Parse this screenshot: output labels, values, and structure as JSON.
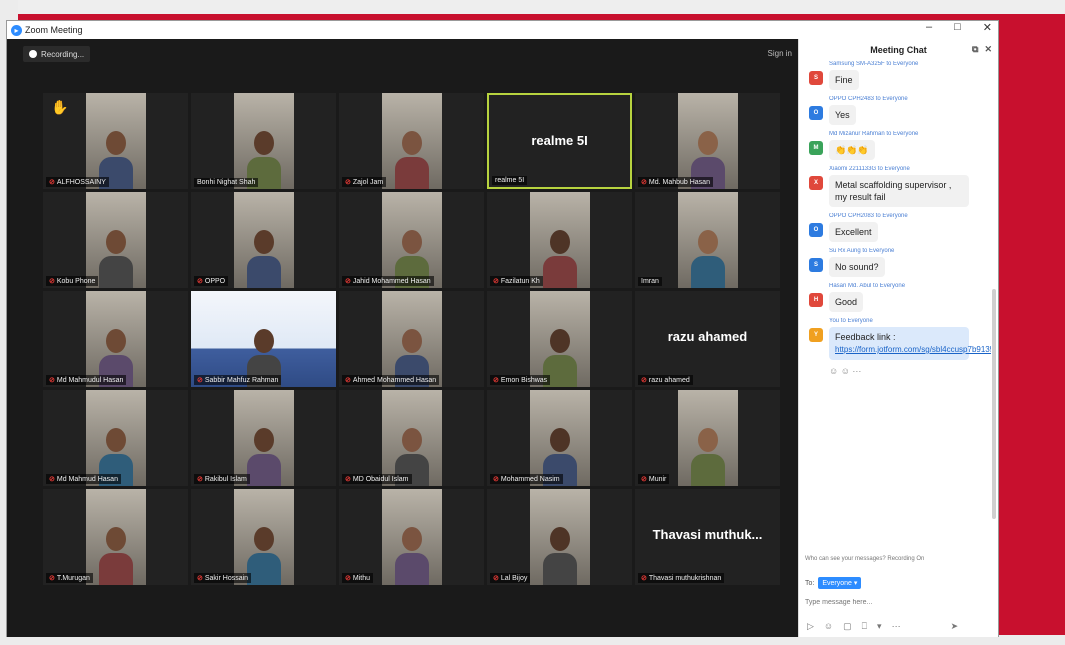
{
  "window": {
    "title": "Zoom Meeting",
    "controls": [
      "–",
      "□",
      "✕"
    ]
  },
  "recording": {
    "label": "Recording..."
  },
  "topbar": {
    "signin": "Sign in"
  },
  "participants": [
    {
      "name": "ALFHOSSAINY",
      "muted": true,
      "hand": true
    },
    {
      "name": "Bonhi Nighat Shah"
    },
    {
      "name": "Zajol Jam",
      "muted": true
    },
    {
      "name": "realme 5I",
      "show_name": "realme 5I",
      "highlight": true
    },
    {
      "name": "Md. Mahbub Hasan",
      "muted": true
    },
    {
      "name": "Kobu Phone",
      "muted": true
    },
    {
      "name": "OPPO",
      "muted": true
    },
    {
      "name": "Jahid Mohammed Hasan",
      "muted": true
    },
    {
      "name": "Fazilatun Kh",
      "muted": true
    },
    {
      "name": "Imran"
    },
    {
      "name": "Md Mahmudul Hasan",
      "muted": true
    },
    {
      "name": "Sabbir Mahfuz Rahman",
      "muted": true,
      "poster": true
    },
    {
      "name": "Ahmed Mohammed Hasan",
      "muted": true
    },
    {
      "name": "Emon Bishwas",
      "muted": true
    },
    {
      "name": "razu ahamed",
      "show_name": "razu ahamed",
      "muted": true
    },
    {
      "name": "Md Mahmud Hasan",
      "muted": true
    },
    {
      "name": "Rakibul Islam",
      "muted": true
    },
    {
      "name": "MD Obaidul Islam",
      "muted": true
    },
    {
      "name": "Mohammed Nasim",
      "muted": true
    },
    {
      "name": "Munir",
      "muted": true
    },
    {
      "name": "T.Murugan",
      "muted": true
    },
    {
      "name": "Sakir Hossain",
      "muted": true
    },
    {
      "name": "Mithu",
      "muted": true
    },
    {
      "name": "Lal Bijoy",
      "muted": true
    },
    {
      "name": "Thavasi muthukrishnan",
      "show_name": "Thavasi muthuk...",
      "muted": true
    }
  ],
  "chat": {
    "title": "Meeting Chat",
    "messages": [
      {
        "avatar": "S",
        "color": "#e0483b",
        "meta": "Samsung SM-A325F to Everyone",
        "text": "Fine"
      },
      {
        "avatar": "O",
        "color": "#2d7be0",
        "meta": "OPPO CPH2483 to Everyone",
        "text": "Yes"
      },
      {
        "avatar": "M",
        "color": "#3aa35a",
        "meta": "Md Mizanur Rahman to Everyone",
        "text": "👏👏👏"
      },
      {
        "avatar": "X",
        "color": "#e0483b",
        "meta": "Xiaomi 2211133G to Everyone",
        "text": "Metal scaffolding supervisor , my result fail"
      },
      {
        "avatar": "O",
        "color": "#2d7be0",
        "meta": "OPPO CPH2083 to Everyone",
        "text": "Excellent"
      },
      {
        "avatar": "S",
        "color": "#2d7be0",
        "meta": "Su Rx Aung to Everyone",
        "text": "No sound?"
      },
      {
        "avatar": "H",
        "color": "#e0483b",
        "meta": "Hasan Md. Abul to Everyone",
        "text": "Good"
      },
      {
        "avatar": "Y",
        "color": "#f0a020",
        "meta": "You to Everyone",
        "text": "Feedback link :",
        "link": "https://form.jotform.com/sg/sbl4ccusp7b9135",
        "blue": true
      }
    ],
    "reactions": "☺ ☺ ···",
    "notice": "Who can see your messages? Recording On",
    "to_label": "To:",
    "to_value": "Everyone ▾",
    "input_placeholder": "Type message here...",
    "toolbar": [
      "▷",
      "☺",
      "▢",
      "⎕",
      "▾",
      "⋯",
      "➤"
    ]
  }
}
